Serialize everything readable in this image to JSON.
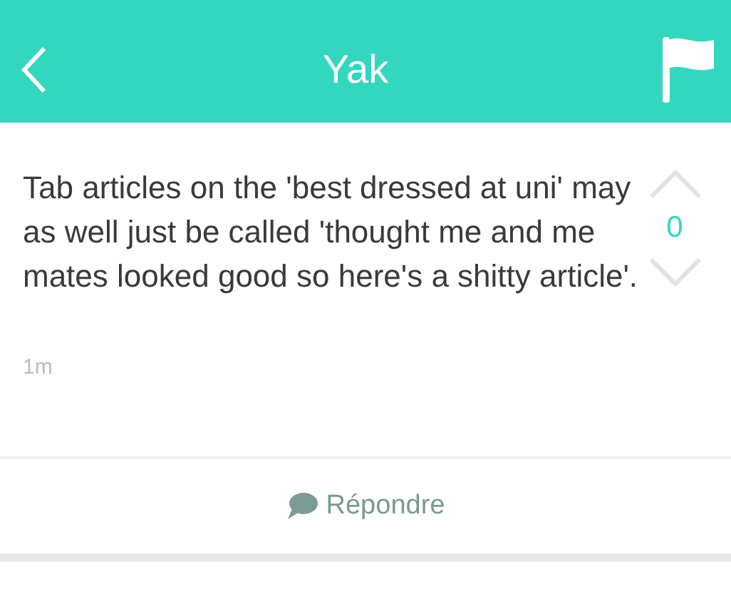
{
  "nav_bar": {
    "title": "Yak"
  },
  "post": {
    "text": "Tab articles on the 'best dressed at uni' may as well just be called 'thought me and me mates looked good so here's a shitty article'.",
    "score": "0",
    "time": "1m"
  },
  "reply_button": {
    "label": "Répondre"
  }
}
